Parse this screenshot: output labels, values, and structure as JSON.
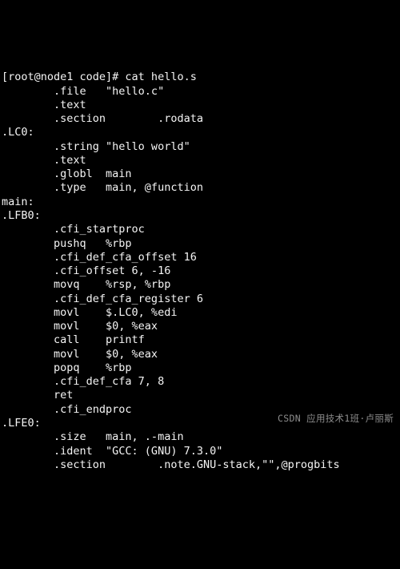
{
  "prompt": "[root@node1 code]# cat hello.s",
  "lines": [
    "        .file   \"hello.c\"",
    "        .text",
    "        .section        .rodata",
    ".LC0:",
    "        .string \"hello world\"",
    "        .text",
    "        .globl  main",
    "        .type   main, @function",
    "main:",
    ".LFB0:",
    "        .cfi_startproc",
    "        pushq   %rbp",
    "        .cfi_def_cfa_offset 16",
    "        .cfi_offset 6, -16",
    "        movq    %rsp, %rbp",
    "        .cfi_def_cfa_register 6",
    "        movl    $.LC0, %edi",
    "        movl    $0, %eax",
    "        call    printf",
    "        movl    $0, %eax",
    "        popq    %rbp",
    "        .cfi_def_cfa 7, 8",
    "        ret",
    "        .cfi_endproc",
    ".LFE0:",
    "        .size   main, .-main",
    "        .ident  \"GCC: (GNU) 7.3.0\"",
    "        .section        .note.GNU-stack,\"\",@progbits"
  ],
  "watermark": "CSDN 应用技术1班·卢丽斯"
}
